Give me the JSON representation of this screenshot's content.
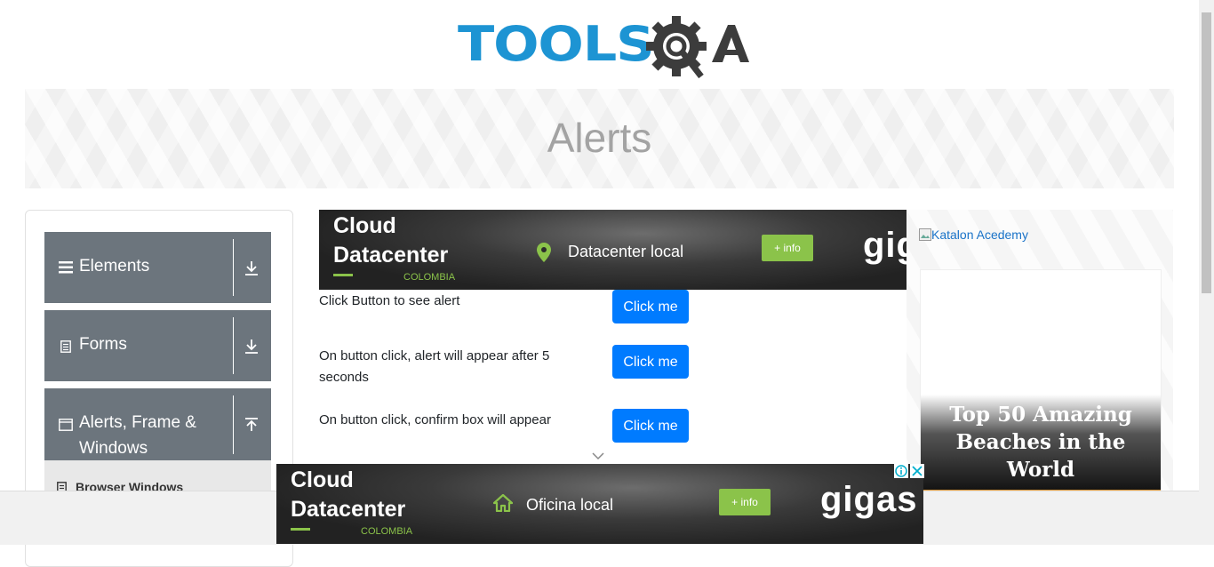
{
  "header": {
    "logo_text": "TOOLS",
    "logo_qa": "QA",
    "page_title": "Alerts"
  },
  "sidebar": {
    "groups": [
      {
        "label": "Elements",
        "icon": "hamburger-icon",
        "toggle": "download-arrow-icon"
      },
      {
        "label": "Forms",
        "icon": "document-icon",
        "toggle": "download-arrow-icon"
      },
      {
        "label": "Alerts, Frame & Windows",
        "label_line1": "Alerts, Frame &",
        "label_line2": "Windows",
        "icon": "window-icon",
        "toggle": "upload-arrow-icon"
      }
    ],
    "sub_item": {
      "label": "Browser Windows",
      "icon": "document-icon"
    }
  },
  "top_ad": {
    "title_line1": "Cloud",
    "title_line2": "Datacenter",
    "country": "COLOMBIA",
    "location": "Datacenter local",
    "info": "+ info",
    "brand": "gigas"
  },
  "bottom_ad": {
    "title_line1": "Cloud",
    "title_line2": "Datacenter",
    "country": "COLOMBIA",
    "location": "Oficina local",
    "info": "+ info",
    "brand": "gigas"
  },
  "alerts": [
    {
      "text": "Click Button to see alert",
      "button": "Click me"
    },
    {
      "text": "On button click, alert will appear after 5 seconds",
      "button": "Click me"
    },
    {
      "text": "On button click, confirm box will appear",
      "button": "Click me"
    }
  ],
  "right_ad": {
    "image_alt": "Katalon Acedemy",
    "card_title_line1": "Top 50 Amazing",
    "card_title_line2": "Beaches in the World"
  },
  "colors": {
    "accent": "#007bff",
    "sidebar_group": "#6c757d",
    "logo_blue": "#1d94d3",
    "logo_dark": "#3c3c3c",
    "ad_green": "#8bc34a"
  }
}
